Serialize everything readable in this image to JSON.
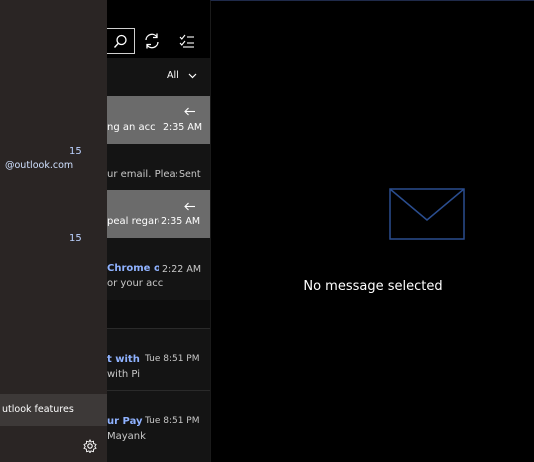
{
  "reading": {
    "empty_text": "No message selected"
  },
  "nav": {
    "count_1": "15",
    "account_suffix": "@outlook.com",
    "count_2": "15",
    "feature_label": "utlook features"
  },
  "list": {
    "filter_label": "All",
    "rows": [
      {
        "preview": "ng an acc",
        "time": "2:35 AM"
      },
      {
        "preview": "ur email. Pleas",
        "status": "Sent"
      },
      {
        "preview": "peal regarc",
        "time": "2:35 AM"
      },
      {
        "sender": "Chrome o",
        "preview": "or your acc",
        "time": "2:22 AM"
      },
      {
        "sender": "t with I",
        "preview": "with Pi",
        "time": "Tue 8:51 PM"
      },
      {
        "sender": "ur PayP",
        "preview": "Mayank",
        "time": "Tue 8:51 PM"
      }
    ]
  },
  "colors": {
    "accent": "#8fb2ff",
    "envelope": "#2a4d8f",
    "selected_row": "#6b6b6b"
  }
}
